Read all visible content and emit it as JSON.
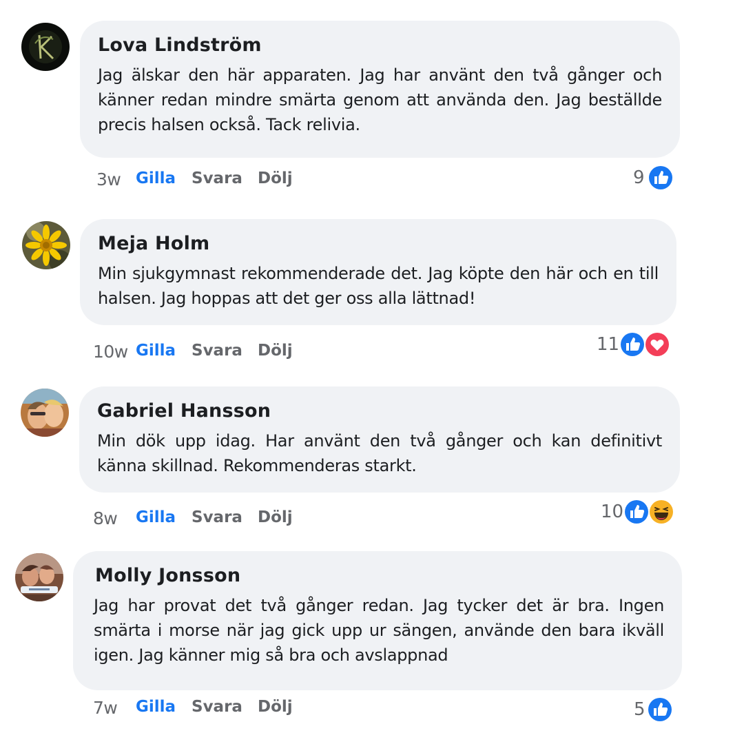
{
  "comments": [
    {
      "name": "Lova Lindström",
      "text": "Jag älskar den här apparaten. Jag har använt den två gånger och känner redan mindre smärta genom att använda den. Jag beställde precis halsen också. Tack relivia.",
      "time": "3w",
      "like_label": "Gilla",
      "reply_label": "Svara",
      "hide_label": "Dölj",
      "reaction_count": "9",
      "reactions": [
        "like-icon"
      ]
    },
    {
      "name": "Meja Holm",
      "text": "Min sjukgymnast rekommenderade det. Jag köpte den här och en till halsen. Jag hoppas att det ger oss alla lättnad!",
      "time": "10w",
      "like_label": "Gilla",
      "reply_label": "Svara",
      "hide_label": "Dölj",
      "reaction_count": "11",
      "reactions": [
        "like-icon",
        "love-icon"
      ]
    },
    {
      "name": "Gabriel Hansson",
      "text": "Min dök upp idag. Har använt den två gånger och kan definitivt känna skillnad. Rekommenderas starkt.",
      "time": "8w",
      "like_label": "Gilla",
      "reply_label": "Svara",
      "hide_label": "Dölj",
      "reaction_count": "10",
      "reactions": [
        "like-icon",
        "haha-icon"
      ]
    },
    {
      "name": "Molly Jonsson",
      "text": "Jag har provat det två gånger redan. Jag tycker det är bra. Ingen smärta i morse när jag gick upp ur sängen, använde den bara ikväll igen. Jag känner mig så bra och avslappnad",
      "time": "7w",
      "like_label": "Gilla",
      "reply_label": "Svara",
      "hide_label": "Dölj",
      "reaction_count": "5",
      "reactions": [
        "like-icon"
      ]
    }
  ],
  "colors": {
    "bubble": "#f0f2f5",
    "like_blue": "#1877f2",
    "muted_text": "#65676b",
    "love_red": "#f33e58",
    "haha_yellow": "#f7b125"
  }
}
